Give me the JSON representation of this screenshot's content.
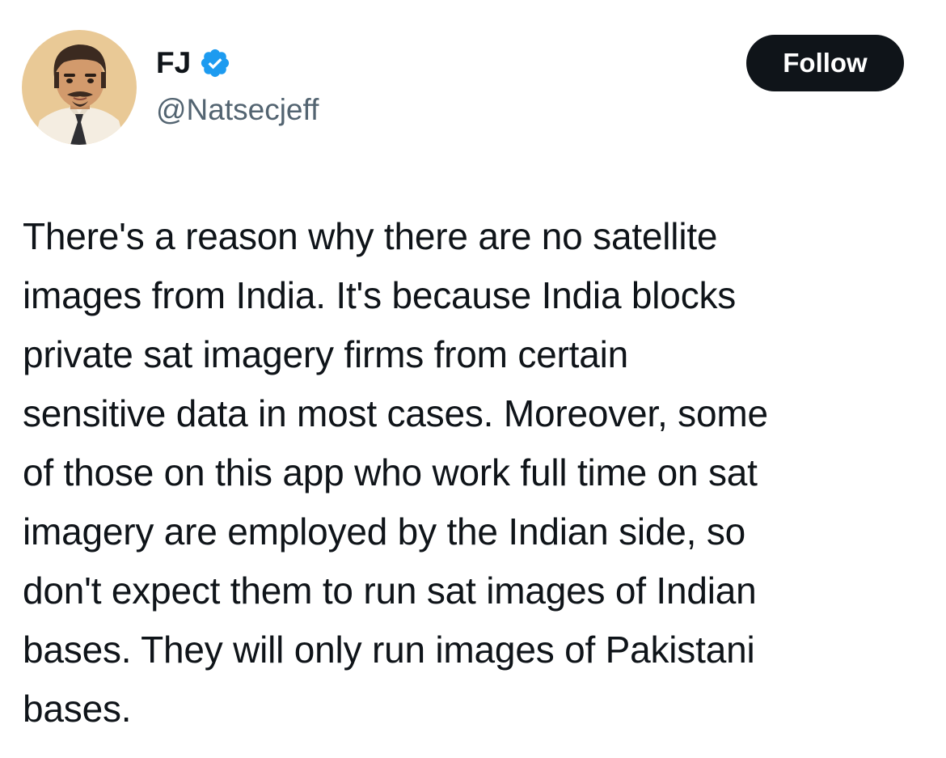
{
  "author": {
    "display_name": "FJ",
    "handle": "@Natsecjeff",
    "verified": true,
    "verified_color": "#1d9bf0"
  },
  "follow_button": {
    "label": "Follow"
  },
  "tweet": {
    "text": "There's a reason why there are no satellite\nimages from India. It's because India blocks\nprivate sat imagery firms from certain\nsensitive data in most cases. Moreover, some\nof those on this app who work full time on sat\nimagery are employed by the Indian side, so\ndon't expect them to run sat images of Indian\nbases. They will only run images of Pakistani\nbases."
  },
  "colors": {
    "text_primary": "#0f1419",
    "text_secondary": "#536471",
    "button_bg": "#0f1419",
    "button_text": "#ffffff"
  },
  "icons": {
    "avatar": "illustrated-man-avatar",
    "verified": "verified-badge-icon"
  }
}
